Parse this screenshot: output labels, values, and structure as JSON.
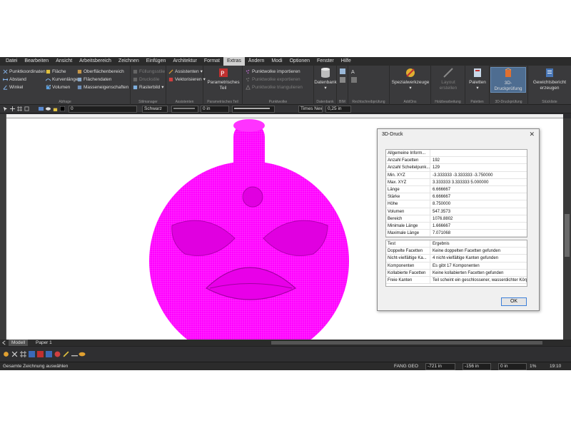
{
  "colors": {
    "accent": "#4e6d91",
    "model": "#ff00ff",
    "app_bg": "#2d2d30",
    "dialog_bg": "#f0f0f0"
  },
  "menu": [
    "Datei",
    "Bearbeiten",
    "Ansicht",
    "Arbeitsbereich",
    "Zeichnen",
    "Einfügen",
    "Architektur",
    "Format",
    "Extras",
    "Ändern",
    "Modi",
    "Optionen",
    "Fenster",
    "Hilfe"
  ],
  "menu_active": "Extras",
  "ribbon": {
    "abfrage": {
      "label": "Abfrage",
      "items": [
        "Punktkoordinaten",
        "Abstand",
        "Winkel",
        "Fläche",
        "Kurvenlänge",
        "Volumen",
        "Oberflächenbereich",
        "Flächendaten",
        "Masseneigenschaften"
      ]
    },
    "stilmanager": {
      "label": "Stilmanager",
      "items": [
        "Füllungsstile",
        "Druckstile",
        "Rasterbild"
      ]
    },
    "assistenten": {
      "label": "Assistenten",
      "items": [
        "Assistenten",
        "Vektorisieren"
      ]
    },
    "param": {
      "label": "Parametrisches Teil",
      "button": "Parametrisches Teil"
    },
    "punktwolke": {
      "label": "Punktwolke",
      "items": [
        "Punktwolke importieren",
        "Punktwolke exportieren",
        "Punktwolke triangulieren"
      ]
    },
    "datenbank": {
      "label": "Datenbank",
      "button": "Datenbank"
    },
    "bim": {
      "label": "BIM"
    },
    "recht": {
      "label": "Rechtschreibprüfung"
    },
    "addons": {
      "label": "AddOns",
      "button": "Spezialwerkzeuge"
    },
    "holz": {
      "label": "Holzbearbeitung",
      "button": "Layout erstellen"
    },
    "paletten": {
      "label": "Paletten",
      "button": "Paletten"
    },
    "druck": {
      "label": "3D-Druckprüfung",
      "button": "3D-Druckprüfung"
    },
    "stueck": {
      "label": "Stückliste",
      "button": "Gewichtsbericht erzeugen"
    }
  },
  "toolbar": {
    "layer": "0",
    "color": "Schwarz",
    "line_value": "0 in",
    "font": "Times New",
    "size": "0,25 in"
  },
  "tabs": {
    "model": "Modell",
    "paper": "Paper 1"
  },
  "status": {
    "message": "Gesamte Zeichnung auswählen",
    "modes": "FANG  GEO",
    "x": "-721 in",
    "y": "-156 in",
    "z": "0 in",
    "zoom": "1%",
    "time": "19:10"
  },
  "dialog": {
    "title": "3D-Druck",
    "info_rows": [
      [
        "Allgemeine Inform...",
        ""
      ],
      [
        "Anzahl Facetten",
        "192"
      ],
      [
        "Anzahl Scheitelpunk...",
        "129"
      ],
      [
        "Min. XYZ",
        "-3.333333   -3.333333   -3.750000"
      ],
      [
        "Max. XYZ",
        "3.333333   3.333333   5.000000"
      ],
      [
        "Länge",
        "6.666667"
      ],
      [
        "Stärke",
        "6.666667"
      ],
      [
        "Höhe",
        "8.750000"
      ],
      [
        "Volumen",
        "547.3573"
      ],
      [
        "Bereich",
        "1076.8802"
      ],
      [
        "Minimale Länge",
        "1.666667"
      ],
      [
        "Maximale Länge",
        "7.071068"
      ]
    ],
    "test_rows": [
      [
        "Test",
        "Ergebnis"
      ],
      [
        "Doppelte Facetten",
        "Keine doppelten Facetten gefunden"
      ],
      [
        "Nicht-vielfältige Ka...",
        "4 nicht-vielfältige Kanten gefunden"
      ],
      [
        "Komponenten",
        "Es gibt 17 Komponenten"
      ],
      [
        "Kollabierte Facetten",
        "Keine kollabierten Facetten gefunden"
      ],
      [
        "Freie Kanten",
        "Teil scheint ein geschlossener, wasserdichter Körp"
      ]
    ],
    "ok": "OK"
  }
}
